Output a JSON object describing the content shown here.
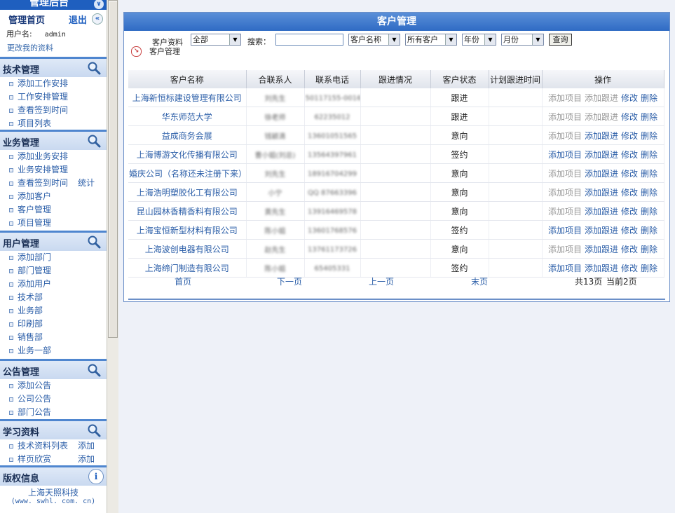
{
  "sidebar": {
    "app_title": "管理后台",
    "home": "管理首页",
    "logout": "退出",
    "username_label": "用户名:",
    "username": "admin",
    "edit_profile": "更改我的资料",
    "sections": [
      {
        "title": "技术管理",
        "items": [
          {
            "label": "添加工作安排"
          },
          {
            "label": "工作安排管理"
          },
          {
            "label": "查看签到时间"
          },
          {
            "label": "项目列表"
          }
        ]
      },
      {
        "title": "业务管理",
        "items": [
          {
            "label": "添加业务安排"
          },
          {
            "label": "业务安排管理"
          },
          {
            "label": "查看签到时间",
            "extra": "统计"
          },
          {
            "label": "添加客户"
          },
          {
            "label": "客户管理"
          },
          {
            "label": "项目管理"
          }
        ]
      },
      {
        "title": "用户管理",
        "items": [
          {
            "label": "添加部门"
          },
          {
            "label": "部门管理"
          },
          {
            "label": "添加用户"
          },
          {
            "label": "技术部"
          },
          {
            "label": "业务部"
          },
          {
            "label": "印刷部"
          },
          {
            "label": "销售部"
          },
          {
            "label": "业务一部"
          }
        ]
      },
      {
        "title": "公告管理",
        "items": [
          {
            "label": "添加公告"
          },
          {
            "label": "公司公告"
          },
          {
            "label": "部门公告"
          }
        ]
      },
      {
        "title": "学习资料",
        "items": [
          {
            "label": "技术资料列表",
            "extra": "添加"
          },
          {
            "label": "样页欣赏",
            "extra": "添加"
          }
        ]
      }
    ],
    "copyright": {
      "title": "版权信息",
      "company": "上海天照科技",
      "url": "(www. swhl. com. cn)"
    }
  },
  "main": {
    "title": "客户管理",
    "breadcrumb": "客户管理",
    "filter": {
      "customer_label": "客户资料",
      "customer_type": "全部",
      "search_label": "搜索：",
      "search_value": "",
      "field": "客户名称",
      "scope": "所有客户",
      "year": "年份",
      "month": "月份",
      "query_button": "查询"
    },
    "columns": [
      "客户名称",
      "合联系人",
      "联系电话",
      "跟进情况",
      "客户状态",
      "计划跟进时间",
      "操作"
    ],
    "ops": [
      "添加项目",
      "添加跟进",
      "修改",
      "删除"
    ],
    "rows": [
      {
        "name": "上海新恒标建设管理有限公司",
        "contact": "刘先生",
        "phone": "50117155-0016",
        "followup": "",
        "status": "跟进",
        "plan": "",
        "ops_gray": 2
      },
      {
        "name": "华东师范大学",
        "contact": "徐老师",
        "phone": "62235012",
        "followup": "",
        "status": "跟进",
        "plan": "",
        "ops_gray": 2
      },
      {
        "name": "益成商务会展",
        "contact": "钱颖滴",
        "phone": "13601051565",
        "followup": "",
        "status": "意向",
        "plan": "",
        "ops_gray": 1
      },
      {
        "name": "上海博游文化传播有限公司",
        "contact": "曹小姐(刘总)",
        "phone": "13564397961",
        "followup": "",
        "status": "签约",
        "plan": "",
        "ops_gray": 0
      },
      {
        "name": "婚庆公司（名称还未注册下来）",
        "contact": "刘先生",
        "phone": "18916704299",
        "followup": "",
        "status": "意向",
        "plan": "",
        "ops_gray": 1
      },
      {
        "name": "上海浩明塑胶化工有限公司",
        "contact": "小宁",
        "phone": "QQ 87663396",
        "followup": "",
        "status": "意向",
        "plan": "",
        "ops_gray": 1
      },
      {
        "name": "昆山园林香精香料有限公司",
        "contact": "黄先生",
        "phone": "13916469578",
        "followup": "",
        "status": "意向",
        "plan": "",
        "ops_gray": 1
      },
      {
        "name": "上海宝恒新型材料有限公司",
        "contact": "陈小姐",
        "phone": "13601768576",
        "followup": "",
        "status": "签约",
        "plan": "",
        "ops_gray": 0
      },
      {
        "name": "上海波创电器有限公司",
        "contact": "赵先生",
        "phone": "13761173726",
        "followup": "",
        "status": "意向",
        "plan": "",
        "ops_gray": 1
      },
      {
        "name": "上海缔门制造有限公司",
        "contact": "陈小姐",
        "phone": "65405331",
        "followup": "",
        "status": "签约",
        "plan": "",
        "ops_gray": 0
      }
    ],
    "pager": {
      "first": "首页",
      "next": "下一页",
      "prev": "上一页",
      "last": "末页",
      "total": "共13页",
      "current": "当前2页"
    }
  }
}
